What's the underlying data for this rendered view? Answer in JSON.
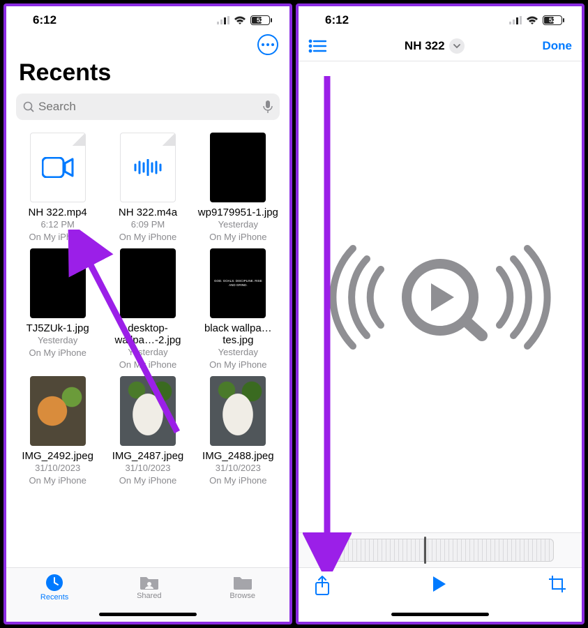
{
  "status": {
    "time": "6:12",
    "battery": "52"
  },
  "left": {
    "title": "Recents",
    "search_placeholder": "Search",
    "files": [
      {
        "name": "NH 322.mp4",
        "time": "6:12 PM",
        "loc": "On My iPhone"
      },
      {
        "name": "NH 322.m4a",
        "time": "6:09 PM",
        "loc": "On My iPhone"
      },
      {
        "name": "wp9179951-1.jpg",
        "time": "Yesterday",
        "loc": "On My iPhone"
      },
      {
        "name": "TJ5ZUk-1.jpg",
        "time": "Yesterday",
        "loc": "On My iPhone"
      },
      {
        "name": "desktop-wallpa…-2.jpg",
        "time": "Yesterday",
        "loc": "On My iPhone"
      },
      {
        "name": "black wallpa…tes.jpg",
        "time": "Yesterday",
        "loc": "On My iPhone"
      },
      {
        "name": "IMG_2492.jpeg",
        "time": "31/10/2023",
        "loc": "On My iPhone"
      },
      {
        "name": "IMG_2487.jpeg",
        "time": "31/10/2023",
        "loc": "On My iPhone"
      },
      {
        "name": "IMG_2488.jpeg",
        "time": "31/10/2023",
        "loc": "On My iPhone"
      }
    ],
    "tabs": {
      "recents": "Recents",
      "shared": "Shared",
      "browse": "Browse"
    }
  },
  "right": {
    "title": "NH 322",
    "done": "Done"
  },
  "thumb_text": {
    "wp": "",
    "desk": "",
    "black": "GOD.\nGOALS.\nDISCIPLINE.\nRISE AND\nGRIND."
  }
}
